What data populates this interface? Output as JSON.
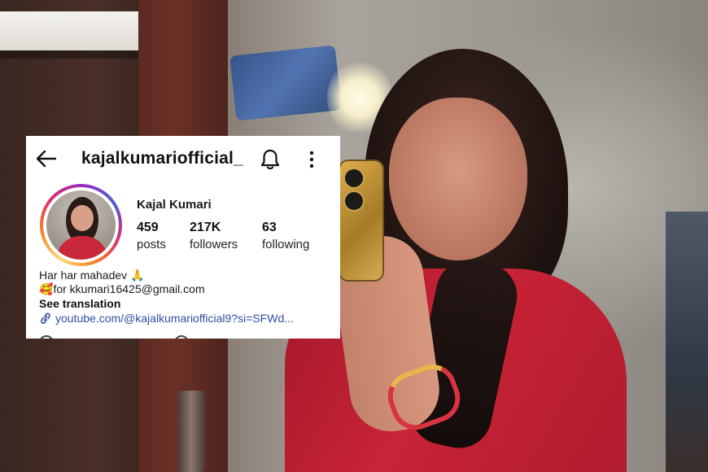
{
  "profile": {
    "username": "kajalkumariofficial_",
    "display_name": "Kajal Kumari",
    "stats": {
      "posts_value": "459",
      "posts_label": "posts",
      "followers_value": "217K",
      "followers_label": "followers",
      "following_value": "63",
      "following_label": "following"
    },
    "bio_line1": "Har har mahadev 🙏",
    "bio_line2_emoji": "🥰",
    "bio_line2_text": "for  kkumari16425@gmail.com",
    "see_translation": "See translation",
    "link": "youtube.com/@kajalkumariofficial9?si=SFWd..."
  },
  "icons": {
    "back": "back-arrow-icon",
    "bell": "bell-icon",
    "more": "more-vertical-icon",
    "link": "link-icon"
  },
  "colors": {
    "link": "#2f4ea6",
    "story_ring": [
      "#feda75",
      "#fa7e1e",
      "#d62976",
      "#962fbf",
      "#4f5bd5"
    ]
  }
}
